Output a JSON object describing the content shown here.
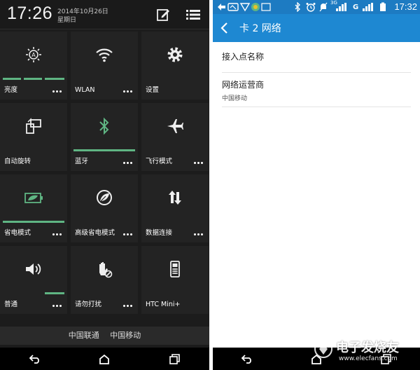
{
  "left_phone": {
    "header": {
      "time": "17:26",
      "date": "2014年10月26日",
      "weekday": "星期日"
    },
    "tiles": [
      {
        "label": "亮度",
        "icon": "brightness-auto-icon",
        "more": true,
        "bars": 3
      },
      {
        "label": "WLAN",
        "icon": "wifi-icon",
        "more": true,
        "bars": 0
      },
      {
        "label": "设置",
        "icon": "gear-icon",
        "more": false,
        "bars": 0
      },
      {
        "label": "自动旋转",
        "icon": "auto-rotate-icon",
        "more": false,
        "bars": 0
      },
      {
        "label": "蓝牙",
        "icon": "bluetooth-icon",
        "more": true,
        "bars": 1
      },
      {
        "label": "飞行模式",
        "icon": "airplane-icon",
        "more": true,
        "bars": 0
      },
      {
        "label": "省电模式",
        "icon": "battery-saver-icon",
        "more": true,
        "bars": 1
      },
      {
        "label": "高级省电模式",
        "icon": "leaf-power-icon",
        "more": true,
        "bars": 0
      },
      {
        "label": "数据连接",
        "icon": "data-arrows-icon",
        "more": true,
        "bars": 0
      },
      {
        "label": "普通",
        "icon": "volume-icon",
        "more": true,
        "bars": 1
      },
      {
        "label": "请勿打扰",
        "icon": "do-not-disturb-hand-icon",
        "more": true,
        "bars": 0
      },
      {
        "label": "HTC Mini+",
        "icon": "htc-mini-phone-icon",
        "more": false,
        "bars": 0
      }
    ],
    "carriers": [
      "中国联通",
      "中国移动"
    ],
    "accent_color": "#5fb583"
  },
  "right_phone": {
    "statusbar": {
      "icons": [
        "notification-icons",
        "bluetooth-icon",
        "alarm-icon",
        "mute-icon",
        "signal-3g-icon",
        "signal-g-icon",
        "battery-icon"
      ],
      "network_a": "3G",
      "network_b": "G",
      "time": "17:32"
    },
    "actionbar": {
      "title": "卡 2 网络"
    },
    "prefs": [
      {
        "title": "接入点名称",
        "summary": ""
      },
      {
        "title": "网络运营商",
        "summary": "中国移动"
      }
    ],
    "primary_color": "#1e88d2",
    "statusbar_color": "#1d7bc2"
  },
  "watermark": {
    "text": "电子发烧友",
    "url_text": "www.elecfans.com"
  }
}
